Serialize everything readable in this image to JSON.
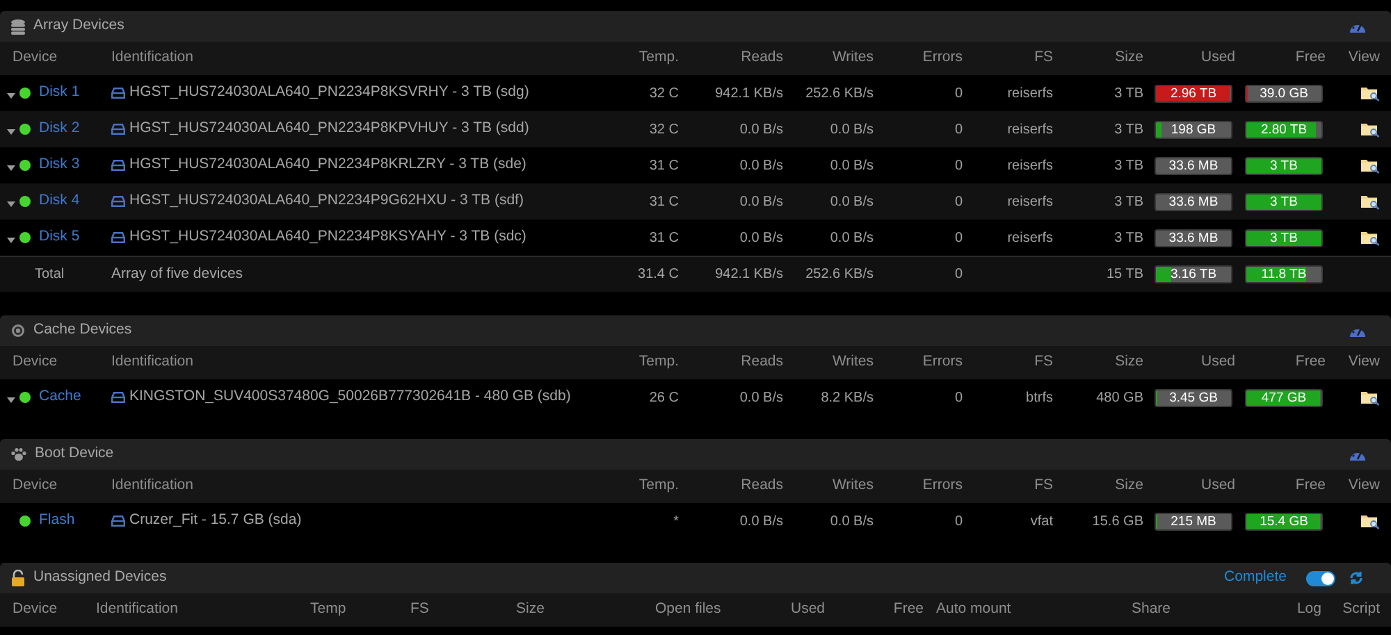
{
  "sections": [
    {
      "kind": "array",
      "title": "Array Devices",
      "columns": [
        "Device",
        "Identification",
        "Temp.",
        "Reads",
        "Writes",
        "Errors",
        "FS",
        "Size",
        "Used",
        "Free",
        "View"
      ],
      "rows": [
        {
          "kind": "disk",
          "expandable": true,
          "device": "Disk 1",
          "identification": "HGST_HUS724030ALA640_PN2234P8KSVRHY - 3 TB (sdg)",
          "temp": "32 C",
          "reads": "942.1 KB/s",
          "writes": "252.6 KB/s",
          "errors": "0",
          "fs": "reiserfs",
          "size": "3 TB",
          "used": {
            "text": "2.96 TB",
            "level": 0.99,
            "color": "#c81a1a"
          },
          "free": {
            "text": "39.0 GB",
            "level": 0.01,
            "color": "#c81a1a"
          }
        },
        {
          "kind": "disk",
          "expandable": true,
          "device": "Disk 2",
          "identification": "HGST_HUS724030ALA640_PN2234P8KPVHUY - 3 TB (sdd)",
          "temp": "32 C",
          "reads": "0.0 B/s",
          "writes": "0.0 B/s",
          "errors": "0",
          "fs": "reiserfs",
          "size": "3 TB",
          "used": {
            "text": "198 GB",
            "level": 0.07,
            "color": "#1fa51f"
          },
          "free": {
            "text": "2.80 TB",
            "level": 0.93,
            "color": "#1fa51f"
          }
        },
        {
          "kind": "disk",
          "expandable": true,
          "device": "Disk 3",
          "identification": "HGST_HUS724030ALA640_PN2234P8KRLZRY - 3 TB (sde)",
          "temp": "31 C",
          "reads": "0.0 B/s",
          "writes": "0.0 B/s",
          "errors": "0",
          "fs": "reiserfs",
          "size": "3 TB",
          "used": {
            "text": "33.6 MB"
          },
          "free": {
            "text": "3 TB",
            "level": 1,
            "color": "#1fa51f"
          }
        },
        {
          "kind": "disk",
          "expandable": true,
          "device": "Disk 4",
          "identification": "HGST_HUS724030ALA640_PN2234P9G62HXU - 3 TB (sdf)",
          "temp": "31 C",
          "reads": "0.0 B/s",
          "writes": "0.0 B/s",
          "errors": "0",
          "fs": "reiserfs",
          "size": "3 TB",
          "used": {
            "text": "33.6 MB"
          },
          "free": {
            "text": "3 TB",
            "level": 1,
            "color": "#1fa51f"
          }
        },
        {
          "kind": "disk",
          "expandable": true,
          "device": "Disk 5",
          "identification": "HGST_HUS724030ALA640_PN2234P8KSYAHY - 3 TB (sdc)",
          "temp": "31 C",
          "reads": "0.0 B/s",
          "writes": "0.0 B/s",
          "errors": "0",
          "fs": "reiserfs",
          "size": "3 TB",
          "used": {
            "text": "33.6 MB"
          },
          "free": {
            "text": "3 TB",
            "level": 1,
            "color": "#1fa51f"
          }
        },
        {
          "kind": "total",
          "device": "Total",
          "identification": "Array of five devices",
          "temp": "31.4 C",
          "reads": "942.1 KB/s",
          "writes": "252.6 KB/s",
          "errors": "0",
          "size": "15 TB",
          "used": {
            "text": "3.16 TB",
            "level": 0.21,
            "color": "#1fa51f"
          },
          "free": {
            "text": "11.8 TB",
            "level": 0.79,
            "color": "#1fa51f"
          }
        }
      ]
    },
    {
      "kind": "cache",
      "title": "Cache Devices",
      "columns": [
        "Device",
        "Identification",
        "Temp.",
        "Reads",
        "Writes",
        "Errors",
        "FS",
        "Size",
        "Used",
        "Free",
        "View"
      ],
      "rows": [
        {
          "kind": "disk",
          "expandable": true,
          "device": "Cache",
          "identification": "KINGSTON_SUV400S37480G_50026B777302641B - 480 GB (sdb)",
          "temp": "26 C",
          "reads": "0.0 B/s",
          "writes": "8.2 KB/s",
          "errors": "0",
          "fs": "btrfs",
          "size": "480 GB",
          "used": {
            "text": "3.45 GB",
            "level": 0.01,
            "color": "#1fa51f"
          },
          "free": {
            "text": "477 GB",
            "level": 0.99,
            "color": "#1fa51f"
          }
        }
      ]
    },
    {
      "kind": "boot",
      "title": "Boot Device",
      "columns": [
        "Device",
        "Identification",
        "Temp.",
        "Reads",
        "Writes",
        "Errors",
        "FS",
        "Size",
        "Used",
        "Free",
        "View"
      ],
      "rows": [
        {
          "kind": "disk",
          "expandable": false,
          "device": "Flash",
          "identification": "Cruzer_Fit - 15.7 GB (sda)",
          "temp": "*",
          "reads": "0.0 B/s",
          "writes": "0.0 B/s",
          "errors": "0",
          "fs": "vfat",
          "size": "15.6 GB",
          "used": {
            "text": "215 MB",
            "level": 0.01,
            "color": "#1fa51f"
          },
          "free": {
            "text": "15.4 GB",
            "level": 0.99,
            "color": "#1fa51f"
          }
        }
      ]
    },
    {
      "kind": "unassigned",
      "title": "Unassigned Devices",
      "toggle": {
        "label": "Complete",
        "on": true
      },
      "columns": [
        "Device",
        "Identification",
        "Temp",
        "FS",
        "Size",
        "Open files",
        "Used",
        "Free",
        "Auto mount",
        "Share",
        "Log",
        "Script"
      ]
    }
  ]
}
